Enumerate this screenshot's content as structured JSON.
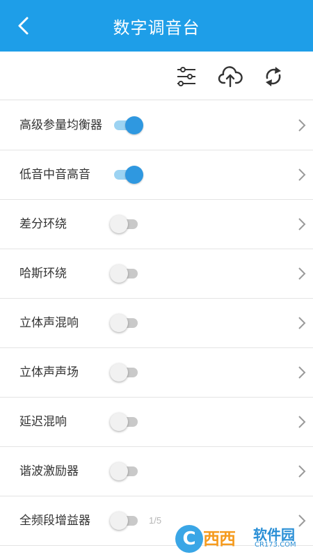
{
  "header": {
    "title": "数字调音台"
  },
  "toolbar": {
    "icons": [
      "filter-icon",
      "cloud-upload-icon",
      "refresh-icon"
    ]
  },
  "colors": {
    "header_bg": "#1e9ee8",
    "toggle_on": "#2f98e0",
    "toggle_track_on": "#9cd3f2",
    "toggle_off": "#f1f1f1"
  },
  "items": [
    {
      "label": "高级参量均衡器",
      "on": true
    },
    {
      "label": "低音中音高音",
      "on": true
    },
    {
      "label": "差分环绕",
      "on": false
    },
    {
      "label": "哈斯环绕",
      "on": false
    },
    {
      "label": "立体声混响",
      "on": false
    },
    {
      "label": "立体声声场",
      "on": false
    },
    {
      "label": "延迟混响",
      "on": false
    },
    {
      "label": "谐波激励器",
      "on": false
    },
    {
      "label": "全频段增益器",
      "on": false
    }
  ],
  "pager": "1/5",
  "watermark": {
    "badge": "C",
    "main": "西西",
    "sub": "软件园",
    "url": "CR173.COM"
  }
}
